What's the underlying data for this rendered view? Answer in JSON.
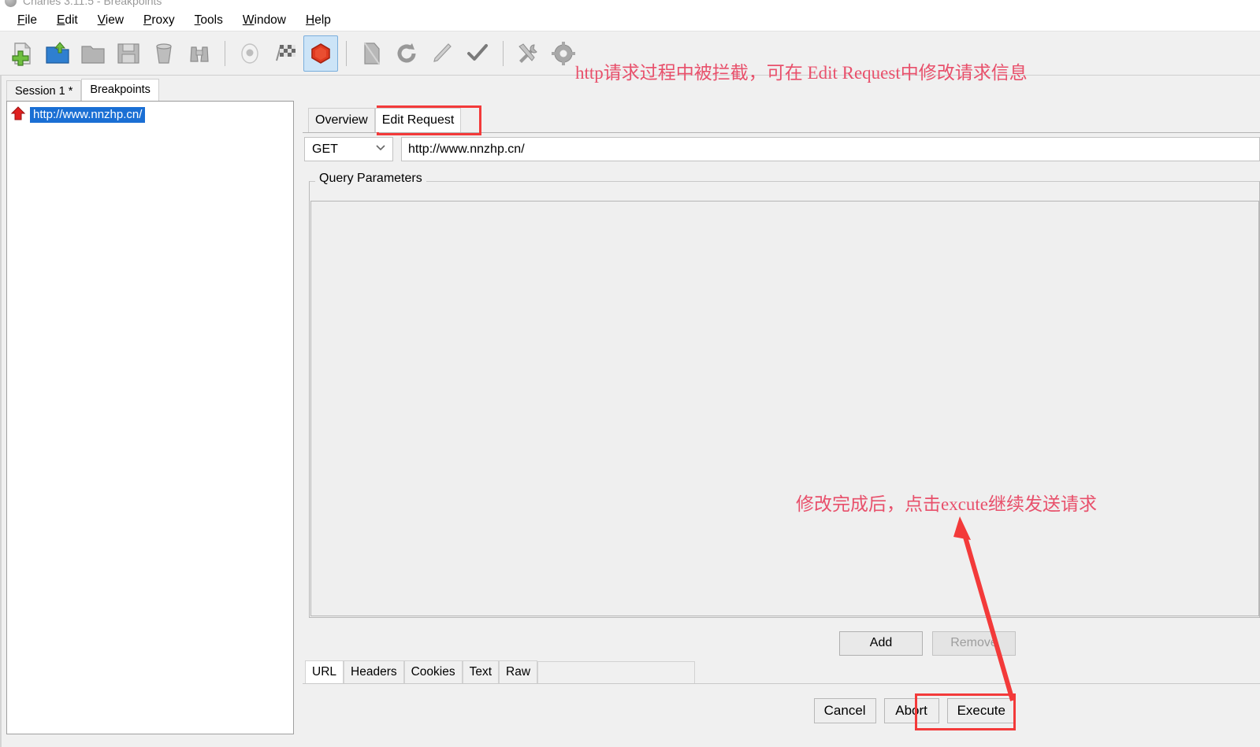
{
  "window": {
    "title": "Charles 3.11.5 - Breakpoints",
    "logo_icon": "charles-logo-icon"
  },
  "menubar": {
    "items": [
      {
        "label": "File",
        "mnemonic": "F"
      },
      {
        "label": "Edit",
        "mnemonic": "E"
      },
      {
        "label": "View",
        "mnemonic": "V"
      },
      {
        "label": "Proxy",
        "mnemonic": "P"
      },
      {
        "label": "Tools",
        "mnemonic": "T"
      },
      {
        "label": "Window",
        "mnemonic": "W"
      },
      {
        "label": "Help",
        "mnemonic": "H"
      }
    ]
  },
  "toolbar": {
    "buttons": [
      {
        "name": "new-session-icon",
        "selected": false
      },
      {
        "name": "open-folder-icon",
        "selected": false
      },
      {
        "name": "save-folder-icon",
        "selected": false
      },
      {
        "name": "save-floppy-icon",
        "selected": false
      },
      {
        "name": "clear-trash-icon",
        "selected": false
      },
      {
        "name": "find-binoculars-icon",
        "selected": false
      },
      {
        "name": "record-icon",
        "selected": false
      },
      {
        "name": "throttle-flags-icon",
        "selected": false
      },
      {
        "name": "breakpoints-stop-icon",
        "selected": true
      },
      {
        "name": "compose-page-icon",
        "selected": false
      },
      {
        "name": "repeat-refresh-icon",
        "selected": false
      },
      {
        "name": "edit-pencil-icon",
        "selected": false
      },
      {
        "name": "validate-check-icon",
        "selected": false
      },
      {
        "name": "tools-wrench-icon",
        "selected": false
      },
      {
        "name": "settings-gear-icon",
        "selected": false
      }
    ]
  },
  "left_panel": {
    "tabs": [
      {
        "label": "Session 1 *",
        "active": false
      },
      {
        "label": "Breakpoints",
        "active": true
      }
    ],
    "breakpoint_items": [
      {
        "icon": "red-up-arrow-icon",
        "url": "http://www.nnzhp.cn/",
        "selected": true
      }
    ]
  },
  "right_panel": {
    "tabs": [
      {
        "label": "Overview",
        "active": false
      },
      {
        "label": "Edit Request",
        "active": true
      }
    ],
    "request": {
      "method": "GET",
      "method_dropdown_icon": "chevron-down-icon",
      "url": "http://www.nnzhp.cn/"
    },
    "query_parameters": {
      "legend": "Query Parameters",
      "rows": []
    },
    "param_buttons": {
      "add_label": "Add",
      "remove_label": "Remove",
      "remove_disabled": true
    },
    "body_tabs": [
      {
        "label": "URL",
        "active": true
      },
      {
        "label": "Headers",
        "active": false
      },
      {
        "label": "Cookies",
        "active": false
      },
      {
        "label": "Text",
        "active": false
      },
      {
        "label": "Raw",
        "active": false
      }
    ],
    "dialog_buttons": [
      {
        "label": "Cancel",
        "name": "cancel-button"
      },
      {
        "label": "Abort",
        "name": "abort-button"
      },
      {
        "label": "Execute",
        "name": "execute-button"
      }
    ]
  },
  "annotations": {
    "top_note": "http请求过程中被拦截，可在 Edit Request中修改请求信息",
    "bottom_note": "修改完成后，点击excute继续发送请求",
    "color": "#e8506b",
    "highlight_color": "#f33a3a"
  }
}
